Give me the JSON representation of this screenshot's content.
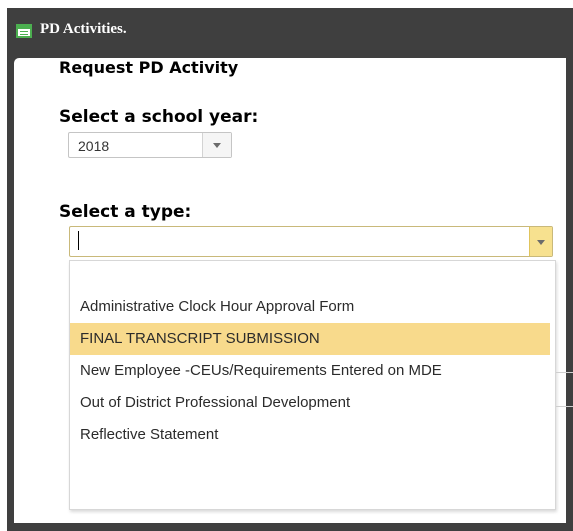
{
  "window": {
    "title": "PD Activities."
  },
  "form": {
    "heading": "Request PD Activity",
    "school_year_label": "Select a school year:",
    "school_year_value": "2018",
    "type_label": "Select a type:",
    "type_value": ""
  },
  "dropdown": {
    "items": [
      {
        "label": "Administrative Clock Hour Approval Form",
        "selected": false
      },
      {
        "label": "FINAL TRANSCRIPT SUBMISSION",
        "selected": true
      },
      {
        "label": "New Employee -CEUs/Requirements Entered on MDE",
        "selected": false
      },
      {
        "label": "Out of District Professional Development",
        "selected": false
      },
      {
        "label": "Reflective Statement",
        "selected": false
      }
    ]
  },
  "colors": {
    "titlebar": "#3f3f3f",
    "selected_item": "#f8da8c",
    "dropdown_button": "#f7e18f"
  },
  "icons": {
    "app_icon": "list-window-icon",
    "dropdown_arrow": "chevron-down-icon"
  }
}
